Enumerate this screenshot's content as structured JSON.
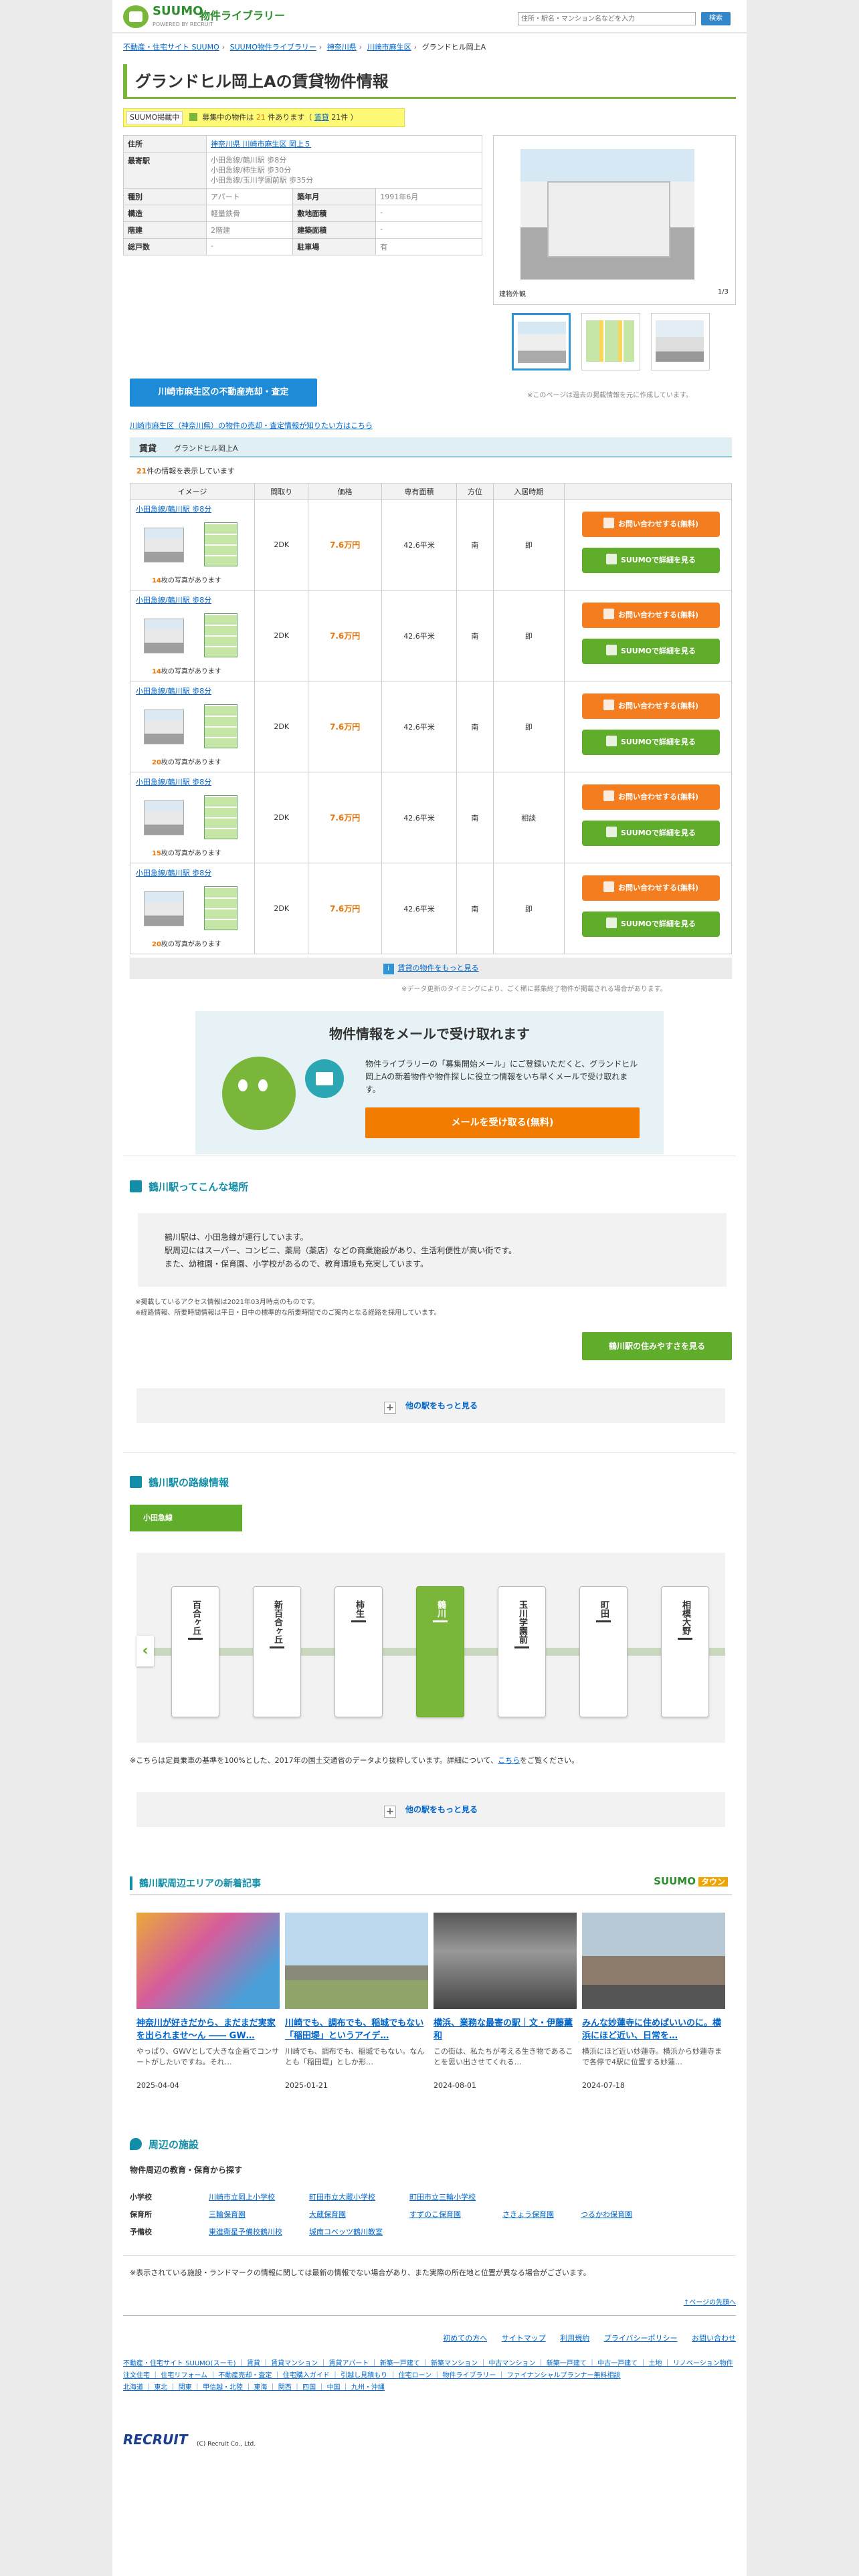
{
  "header": {
    "brand": "SUUMO",
    "lib": "物件ライブラリー",
    "sub": "POWERED BY RECRUIT",
    "search_placeholder": "住所・駅名・マンション名などを入力",
    "search_button": "検索"
  },
  "breadcrumb": [
    "不動産・住宅サイト SUUMO",
    "SUUMO物件ライブラリー",
    "神奈川県",
    "川崎市麻生区",
    "グランドヒル岡上A"
  ],
  "page_title": "グランドヒル岡上Aの賃貸物件情報",
  "notice": {
    "label": "SUUMO掲載中",
    "text_pre": "募集中の物件は",
    "count": "21",
    "text_post": "件あります（",
    "link": "賃貸",
    "count_link": "21件",
    "close": "）"
  },
  "info": {
    "rows": [
      {
        "k": "住所",
        "v": "神奈川県 川崎市麻生区 岡上５",
        "k2": "",
        "v2": ""
      },
      {
        "k": "最寄駅",
        "v": "小田急線/鶴川駅 歩8分\n小田急線/柿生駅 歩30分\n小田急線/玉川学園前駅 歩35分",
        "k2": "",
        "v2": ""
      },
      {
        "k": "種別",
        "v": "アパート",
        "k2": "築年月",
        "v2": "1991年6月"
      },
      {
        "k": "構造",
        "v": "軽量鉄骨",
        "k2": "敷地面積",
        "v2": "-"
      },
      {
        "k": "階建",
        "v": "2階建",
        "k2": "建築面積",
        "v2": "-"
      },
      {
        "k": "総戸数",
        "v": "-",
        "k2": "駐車場",
        "v2": "有"
      }
    ]
  },
  "photo": {
    "caption": "建物外観",
    "count": "1/3"
  },
  "consult_button": "川崎市麻生区の不動産売却・査定",
  "consult_note": "※このページは過去の掲載情報を元に作成しています。",
  "consult_link": "川崎市麻生区（神奈川県）の物件の売却・査定情報が知りたい方はこちら",
  "rent": {
    "section": "賃貸",
    "building": "グランドヒル岡上A",
    "count": "21",
    "count_suffix": "件の情報を表示しています",
    "headers": [
      "イメージ",
      "間取り",
      "価格",
      "専有面積",
      "方位",
      "入居時期",
      ""
    ],
    "rows": [
      {
        "station": "小田急線/鶴川駅 歩8分",
        "photos": "14",
        "layout": "2DK",
        "price": "7.6万円",
        "area": "42.6平米",
        "dir": "南",
        "move": "即"
      },
      {
        "station": "小田急線/鶴川駅 歩8分",
        "photos": "14",
        "layout": "2DK",
        "price": "7.6万円",
        "area": "42.6平米",
        "dir": "南",
        "move": "即"
      },
      {
        "station": "小田急線/鶴川駅 歩8分",
        "photos": "20",
        "layout": "2DK",
        "price": "7.6万円",
        "area": "42.6平米",
        "dir": "南",
        "move": "即"
      },
      {
        "station": "小田急線/鶴川駅 歩8分",
        "photos": "15",
        "layout": "2DK",
        "price": "7.6万円",
        "area": "42.6平米",
        "dir": "南",
        "move": "相談"
      },
      {
        "station": "小田急線/鶴川駅 歩8分",
        "photos": "20",
        "layout": "2DK",
        "price": "7.6万円",
        "area": "42.6平米",
        "dir": "南",
        "move": "即"
      }
    ],
    "photos_suffix": "枚の写真があります",
    "btn_inquiry": "お問い合わせする(無料)",
    "btn_detail": "SUUMOで詳細を見る",
    "more": "賃貸の物件をもっと見る",
    "more_icon": "i",
    "more_note": "※データ更新のタイミングにより、ごく稀に募集終了物件が掲載される場合があります。"
  },
  "mail": {
    "title": "物件情報をメールで受け取れます",
    "text": "物件ライブラリーの「募集開始メール」にご登録いただくと、グランドヒル岡上Aの新着物件や物件探しに役立つ情報をいち早くメールで受け取れます。",
    "button": "メールを受け取る(無料)"
  },
  "station": {
    "heading": "鶴川駅ってこんな場所",
    "body": [
      "鶴川駅は、小田急線が運行しています。",
      "駅周辺にはスーパー、コンビニ、薬局（薬店）などの商業施設があり、生活利便性が高い街です。",
      "また、幼稚園・保育園、小学校があるので、教育環境も充実しています。"
    ],
    "notes": [
      "※掲載しているアクセス情報は2021年03月時点のものです。",
      "※経路情報、所要時間情報は平日・日中の標準的な所要時間でのご案内となる経路を採用しています。"
    ],
    "live_button": "鶴川駅の住みやすさを見る",
    "more": "他の駅をもっと見る"
  },
  "route": {
    "heading": "鶴川駅の路線情報",
    "line": "小田急線",
    "stations": [
      "百合ヶ丘",
      "新百合ヶ丘",
      "柿生",
      "鶴川",
      "玉川学園前",
      "町田",
      "相模大野"
    ],
    "current": 3,
    "note_pre": "※こちらは定員乗車の基準を100%とした、2017年の国土交通省のデータより抜粋しています。詳細について、",
    "note_link": "こちら",
    "note_post": "をご覧ください。",
    "more": "他の駅をもっと見る"
  },
  "town": {
    "heading": "鶴川駅周辺エリアの新着記事",
    "logo": "SUUMO",
    "logo_tag": "タウン",
    "articles": [
      {
        "title": "神奈川が好きだから、まだまだ実家を出られませ〜ん ―― GW…",
        "desc": "やっぱり、GWVとして大きな企画でコンサートがしたいですね。それ…",
        "date": "2025-04-04"
      },
      {
        "title": "川崎でも、調布でも、稲城でもない「稲田堤」というアイデ…",
        "desc": "川崎でも、調布でも、稲城でもない。なんとも「稲田堤」としか形…",
        "date": "2025-01-21"
      },
      {
        "title": "横浜、業務な最寄の駅｜文・伊藤薫和",
        "desc": "この街は、私たちが考える生き物であることを思い出させてくれる…",
        "date": "2024-08-01"
      },
      {
        "title": "みんな妙蓮寺に住めばいいのに。横浜にほど近い、日常を…",
        "desc": "横浜にほど近い妙蓮寺。横浜から妙蓮寺まで各停で4駅に位置する妙蓮…",
        "date": "2024-07-18"
      }
    ]
  },
  "facility": {
    "heading": "周辺の施設",
    "sub": "物件周辺の教育・保育から探す",
    "rows": [
      {
        "k": "小学校",
        "v": [
          "川崎市立岡上小学校",
          "町田市立大蔵小学校",
          "町田市立三輪小学校"
        ]
      },
      {
        "k": "保育所",
        "v": [
          "三輪保育園",
          "大蔵保育園",
          "すずのこ保育園",
          "さきょう保育園",
          "つるかわ保育園"
        ]
      },
      {
        "k": "予備校",
        "v": [
          "東進衛星予備校鶴川校",
          "城南コベッツ鶴川教室"
        ]
      }
    ],
    "note": "※表示されている施設・ランドマークの情報に関しては最新の情報でない場合があり、また実際の所在地と位置が異なる場合がございます。",
    "pagetop": "↑ページの先頭へ"
  },
  "footer": {
    "links": [
      "初めての方へ",
      "サイトマップ",
      "利用規約",
      "プライバシーポリシー",
      "お問い合わせ"
    ],
    "line1": "不動産・住宅サイト SUUMO(スーモ) ｜ 賃貸 ｜ 賃貸マンション ｜ 賃貸アパート ｜ 新築一戸建て ｜ 新築マンション ｜ 中古マンション ｜ 新築一戸建て ｜ 中古一戸建て ｜ 土地 ｜ リノベーション物件",
    "line2": "注文住宅 ｜ 住宅リフォーム ｜ 不動産売却・査定 ｜ 住宅購入ガイド ｜ 引越し見積もり ｜ 住宅ローン ｜ 物件ライブラリー ｜ ファイナンシャルプランナー無料相談",
    "line3": "北海道 ｜ 東北 ｜ 関東 ｜ 甲信越・北陸 ｜ 東海 ｜ 関西 ｜ 四国 ｜ 中国 ｜ 九州・沖縄",
    "recruit": "RECRUIT",
    "copy": "(C) Recruit Co., Ltd."
  }
}
